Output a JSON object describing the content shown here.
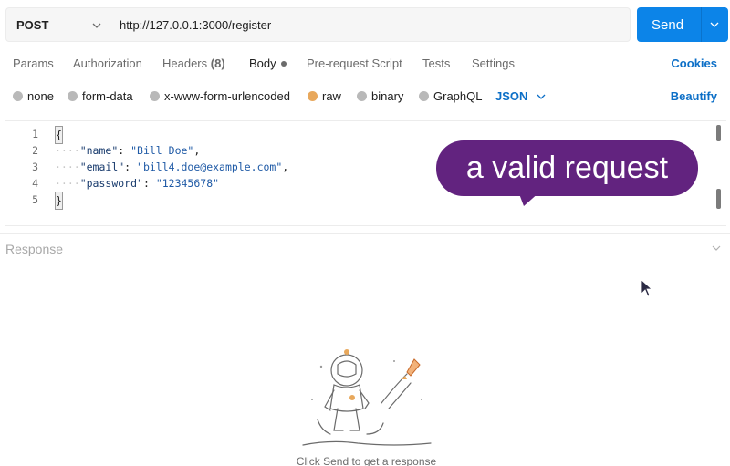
{
  "request": {
    "method": "POST",
    "url": "http://127.0.0.1:3000/register",
    "send_label": "Send"
  },
  "tabs": [
    {
      "label": "Params"
    },
    {
      "label": "Authorization"
    },
    {
      "label": "Headers",
      "count": "(8)"
    },
    {
      "label": "Body",
      "active": true
    },
    {
      "label": "Pre-request Script"
    },
    {
      "label": "Tests"
    },
    {
      "label": "Settings"
    }
  ],
  "cookies_label": "Cookies",
  "body_types": [
    {
      "label": "none"
    },
    {
      "label": "form-data"
    },
    {
      "label": "x-www-form-urlencoded"
    },
    {
      "label": "raw",
      "selected": true
    },
    {
      "label": "binary"
    },
    {
      "label": "GraphQL"
    }
  ],
  "format_label": "JSON",
  "beautify_label": "Beautify",
  "editor": {
    "line_numbers": [
      "1",
      "2",
      "3",
      "4",
      "5"
    ],
    "open_brace": "{",
    "close_brace": "}",
    "fields": [
      {
        "key": "\"name\"",
        "value": "\"Bill Doe\"",
        "sep": ","
      },
      {
        "key": "\"email\"",
        "value": "\"bill4.doe@example.com\"",
        "sep": ","
      },
      {
        "key": "\"password\"",
        "value": "\"12345678\"",
        "sep": ""
      }
    ]
  },
  "callout_text": "a valid request",
  "response": {
    "title": "Response",
    "empty_hint": "Click Send to get a response"
  },
  "colors": {
    "accent": "#0c84e8",
    "link": "#0c6fc7",
    "callout": "#62237f",
    "raw_radio": "#e8a85c"
  }
}
